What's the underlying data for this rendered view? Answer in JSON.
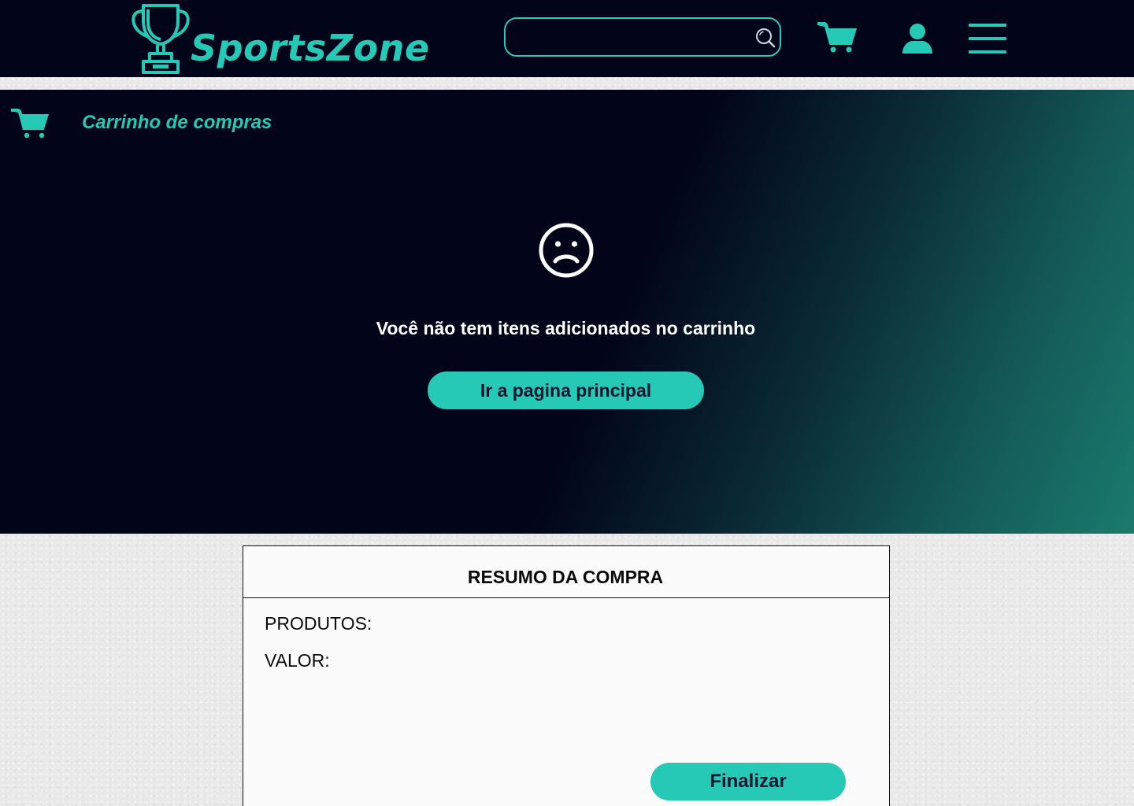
{
  "brand": {
    "name_first": "Sports",
    "name_second": "Zone",
    "logo_icon": "trophy-icon"
  },
  "colors": {
    "accent": "#26c9b6",
    "header_bg": "#02041a",
    "hero_gradient_end": "#1a7a6e",
    "summary_bg": "#fbfbfb"
  },
  "header": {
    "search": {
      "value": "",
      "placeholder": "",
      "icon": "search-icon"
    },
    "cart_icon": "cart-icon",
    "user_icon": "user-icon",
    "menu_icon": "hamburger-menu-icon"
  },
  "cart": {
    "icon": "cart-icon",
    "title": "Carrinho de compras",
    "empty_icon": "sad-face-icon",
    "empty_message": "Você não tem itens adicionados no carrinho",
    "home_button_label": "Ir a pagina principal"
  },
  "summary": {
    "title": "RESUMO DA COMPRA",
    "products_label": "PRODUTOS:",
    "value_label": "VALOR:",
    "finish_button_label": "Finalizar"
  }
}
